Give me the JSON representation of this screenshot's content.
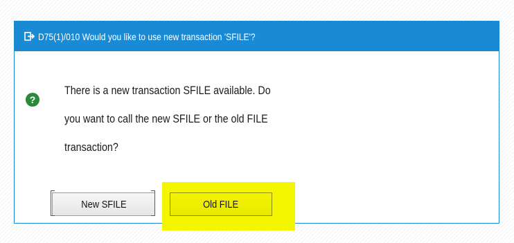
{
  "dialog": {
    "title": "D75(1)/010 Would you like to use new transaction 'SFILE'?",
    "title_icon": "transaction-arrow-icon",
    "message_lines": [
      "There is a new transaction SFILE available. Do",
      "you want to call the new SFILE or the old FILE",
      "transaction?"
    ],
    "question_icon": "question-mark-icon",
    "question_glyph": "?"
  },
  "buttons": {
    "new_label": "New SFILE",
    "old_label": "Old FILE"
  },
  "colors": {
    "titlebar": "#1a8ad4",
    "question_icon": "#2a8a3a",
    "highlight": "#f4f600",
    "focus_bracket": "#e02020"
  }
}
